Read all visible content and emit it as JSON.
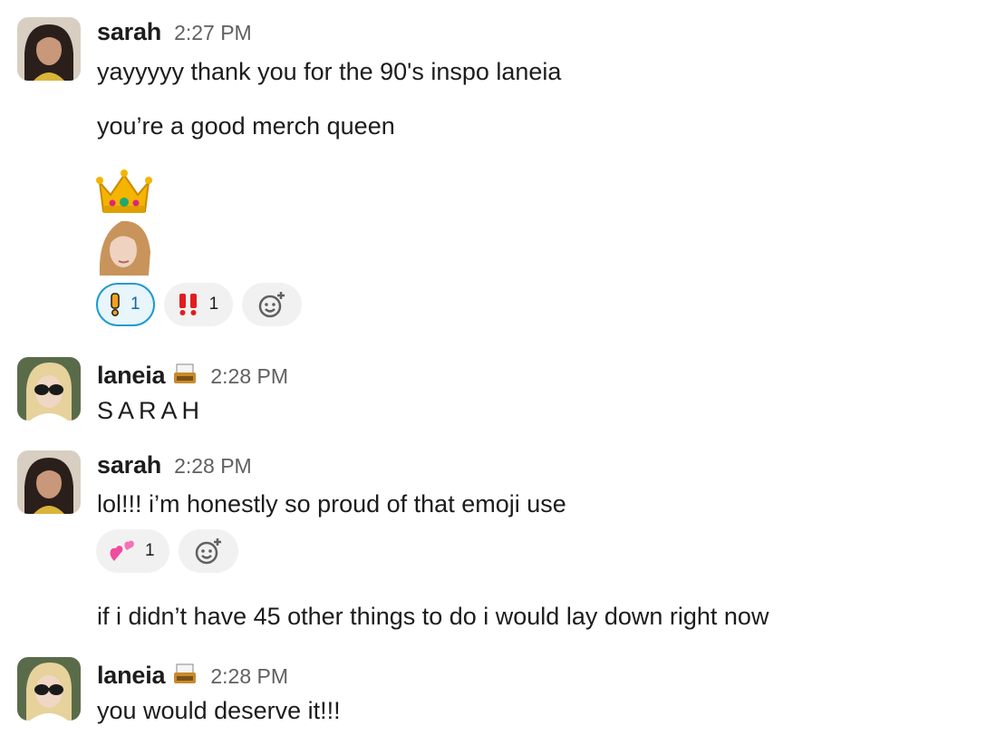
{
  "messages": [
    {
      "author": "sarah",
      "time": "2:27 PM",
      "lines": [
        "yayyyyy thank you for the 90's inspo laneia",
        "you’re a good merch queen"
      ],
      "emojis": [
        "crown-emoji",
        "custom-face-emoji"
      ],
      "reactions": [
        {
          "emoji": "exclamation-icon",
          "count": "1",
          "active": true
        },
        {
          "emoji": "double-exclamation-icon",
          "count": "1",
          "active": false
        }
      ]
    },
    {
      "author": "laneia",
      "status_emoji": "typewriter-emoji",
      "time": "2:28 PM",
      "lines": [
        "SARAH"
      ]
    },
    {
      "author": "sarah",
      "time": "2:28 PM",
      "lines": [
        "lol!!! i’m honestly so proud of that emoji use",
        "if i didn’t have 45 other things to do i would lay down right now"
      ],
      "reactions": [
        {
          "emoji": "two-hearts-emoji",
          "count": "1",
          "active": false
        }
      ]
    },
    {
      "author": "laneia",
      "status_emoji": "typewriter-emoji",
      "time": "2:28 PM",
      "lines": [
        "you would deserve it!!!"
      ]
    }
  ],
  "colors": {
    "timestamp": "#616061",
    "active_reaction_border": "#1d9bd1",
    "active_reaction_bg": "#e8f5fa",
    "reaction_bg": "#f1f1f1"
  }
}
